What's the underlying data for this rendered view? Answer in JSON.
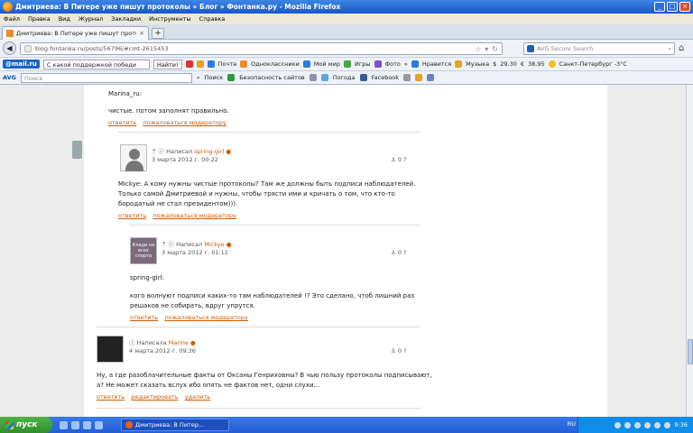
{
  "window": {
    "title": "Дмитриева: В Питере уже пишут протоколы » Блог » Фонтанка.ру - Mozilla Firefox"
  },
  "menu": [
    "Файл",
    "Правка",
    "Вид",
    "Журнал",
    "Закладки",
    "Инструменты",
    "Справка"
  ],
  "tab": {
    "title": "Дмитриева: В Питере уже пишут протоко...",
    "new_tab": "+"
  },
  "nav": {
    "url": "blog.fontanka.ru/posts/56796/#cmt-2615453",
    "search_placeholder": "AVG Secure Search"
  },
  "mailru_toolbar": {
    "logo": "@mail.ru",
    "query": "С какой поддержкой победи",
    "find": "Найти!",
    "items": [
      "Почта",
      "Одноклассники",
      "Мой мир",
      "Игры",
      "Фото",
      "»",
      "Нравится",
      "Музыка"
    ],
    "usd": "29.30",
    "eur": "38.95",
    "weather": "Санкт-Петербург -3°C"
  },
  "avg_toolbar": {
    "logo": "AVG",
    "search_placeholder": "Поиск",
    "search_btn": "Поиск",
    "safety": "Безопасность сайтов",
    "weather": "Погода",
    "facebook": "Facebook"
  },
  "comments": {
    "c0": {
      "quote_author": "Marina_ru:",
      "text": "чистые. потом заполнят правильно.",
      "actions": [
        "ответить",
        "пожаловаться модератору"
      ]
    },
    "c1": {
      "prefix": "Написал",
      "author": "spring-girl",
      "date": "3 марта 2012 г. 00:22",
      "votes": "0",
      "lines": [
        "Mickye: А кому нужны чистые протоколы? Там же должны быть подписи наблюдателей.",
        "Только самой Дмитриевой и нужны, чтобы трясти ими и кричать о том, что кто-то",
        "бородатый не стал президентом))). "
      ],
      "actions": [
        "ответить",
        "пожаловаться модератору"
      ]
    },
    "c2": {
      "prefix": "Написал",
      "author": "Mickye",
      "date": "3 марта 2012 г. 01:12",
      "votes": "0",
      "avatar_text": "Клади на всех спорта",
      "quote_author": "spring-girl:",
      "lines": [
        "кого волнуют подписи каких-то там наблюдателей !? Это сделано, чтоб лишний раз",
        "решаков не собирать, вдруг упрутся."
      ],
      "actions": [
        "ответить",
        "пожаловаться модератору"
      ]
    },
    "c3": {
      "prefix": "Написала",
      "author": "Marine",
      "date": "4 марта 2012 г. 09:36",
      "votes": "0",
      "lines": [
        "Ну, а где разоблачительные факты от Оксаны Генриховны? В чью пользу протоколы подписывают,",
        "а? Не может сказать вслух ибо опять не фактов нет, одни слухи..."
      ],
      "actions": [
        "ответить",
        "редактировать",
        "удалить"
      ]
    }
  },
  "taskbar": {
    "start": "пуск",
    "task": "Дмитриева: В Питер...",
    "lang": "RU",
    "clock": "9:36"
  }
}
